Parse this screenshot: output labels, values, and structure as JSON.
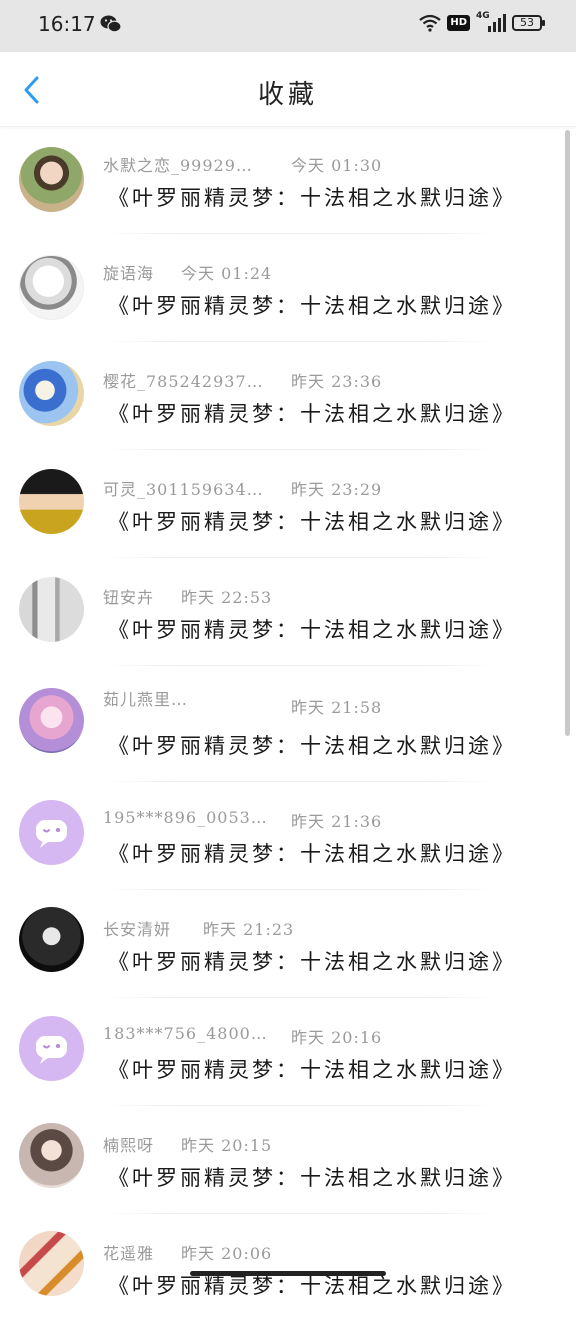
{
  "status": {
    "time": "16:17",
    "network": "4G",
    "hd": "HD",
    "battery": "53"
  },
  "header": {
    "title": "收藏",
    "back_icon": "chevron-left-icon",
    "accent_color": "#2b9bf4"
  },
  "items": [
    {
      "name": "水默之恋_99929…",
      "time": "今天 01:30",
      "content": "《叶罗丽精灵梦：十法相之水默归途》",
      "avatar": "avatar-photo"
    },
    {
      "name": "旋语海",
      "time": "今天 01:24",
      "content": "《叶罗丽精灵梦：十法相之水默归途》",
      "avatar": "avatar-sketch"
    },
    {
      "name": "樱花_785242937…",
      "time": "昨天 23:36",
      "content": "《叶罗丽精灵梦：十法相之水默归途》",
      "avatar": "avatar-blue-lantern"
    },
    {
      "name": "可灵_301159634…",
      "time": "昨天 23:29",
      "content": "《叶罗丽精灵梦：十法相之水默归途》",
      "avatar": "avatar-cartoon"
    },
    {
      "name": "钮安卉",
      "time": "昨天 22:53",
      "content": "《叶罗丽精灵梦：十法相之水默归途》",
      "avatar": "avatar-curtain"
    },
    {
      "name": "茹儿燕里…",
      "time": "昨天 21:58",
      "content": "《叶罗丽精灵梦：十法相之水默归途》",
      "avatar": "avatar-pink-anime"
    },
    {
      "name": "195***896_0053…",
      "time": "昨天 21:36",
      "content": "《叶罗丽精灵梦：十法相之水默归途》",
      "avatar": "default-chat-avatar"
    },
    {
      "name": "长安清妍",
      "time": "昨天 21:23",
      "content": "《叶罗丽精灵梦：十法相之水默归途》",
      "avatar": "avatar-supreme"
    },
    {
      "name": "183***756_4800…",
      "time": "昨天 20:16",
      "content": "《叶罗丽精灵梦：十法相之水默归途》",
      "avatar": "default-chat-avatar"
    },
    {
      "name": "楠熙呀",
      "time": "昨天 20:15",
      "content": "《叶罗丽精灵梦：十法相之水默归途》",
      "avatar": "avatar-girl"
    },
    {
      "name": "花遥雅",
      "time": "昨天 20:06",
      "content": "《叶罗丽精灵梦：十法相之水默归途》",
      "avatar": "avatar-pins"
    }
  ]
}
